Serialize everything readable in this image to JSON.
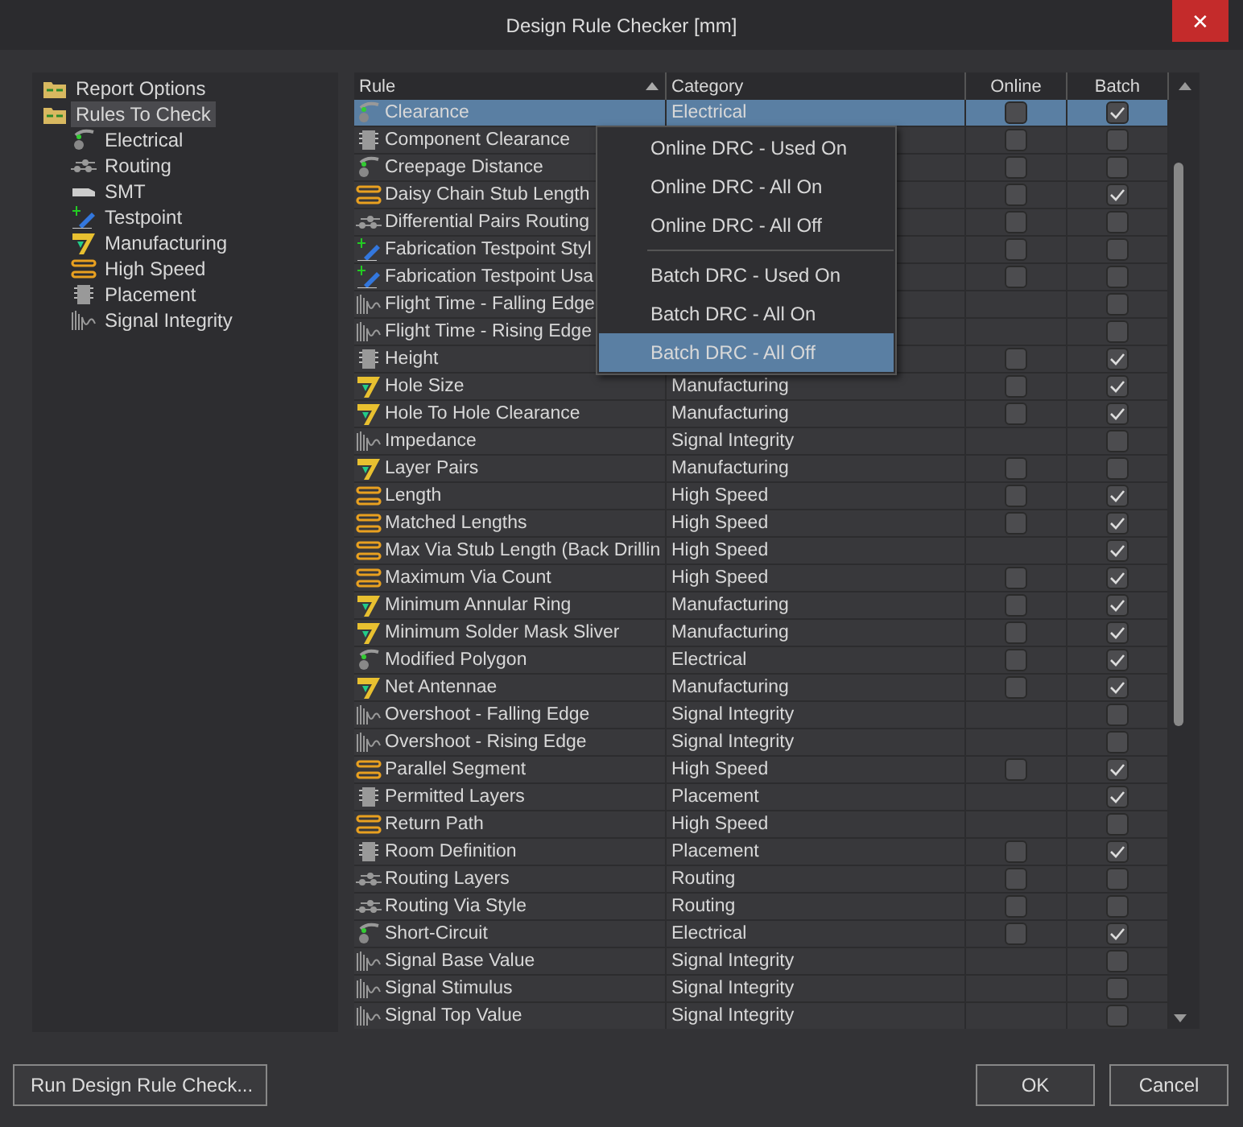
{
  "window": {
    "title": "Design Rule Checker [mm]",
    "close": "✕"
  },
  "tree": [
    {
      "label": "Report Options",
      "kind": "folder",
      "selected": false
    },
    {
      "label": "Rules To Check",
      "kind": "folder",
      "selected": true,
      "children": [
        {
          "label": "Electrical",
          "kind": "electrical"
        },
        {
          "label": "Routing",
          "kind": "routing"
        },
        {
          "label": "SMT",
          "kind": "smt"
        },
        {
          "label": "Testpoint",
          "kind": "testpoint"
        },
        {
          "label": "Manufacturing",
          "kind": "manufacturing"
        },
        {
          "label": "High Speed",
          "kind": "highspeed"
        },
        {
          "label": "Placement",
          "kind": "placement"
        },
        {
          "label": "Signal Integrity",
          "kind": "signal"
        }
      ]
    }
  ],
  "table": {
    "columns": [
      "Rule",
      "Category",
      "Online",
      "Batch"
    ],
    "rows": [
      {
        "rule": "Clearance",
        "kind": "electrical",
        "category": "Electrical",
        "online": false,
        "batch": true,
        "selected": true
      },
      {
        "rule": "Component Clearance",
        "kind": "placement",
        "online": false,
        "batch": false,
        "selected": false
      },
      {
        "rule": "Creepage Distance",
        "kind": "electrical",
        "online": false,
        "batch": false,
        "selected": false
      },
      {
        "rule": "Daisy Chain Stub Length",
        "kind": "highspeed",
        "online": false,
        "batch": true,
        "selected": false
      },
      {
        "rule": "Differential Pairs Routing",
        "kind": "routing",
        "online": false,
        "batch": false,
        "selected": false
      },
      {
        "rule": "Fabrication Testpoint Styl",
        "kind": "testpoint",
        "online": false,
        "batch": false,
        "selected": false
      },
      {
        "rule": "Fabrication Testpoint Usa",
        "kind": "testpoint",
        "online": false,
        "batch": false,
        "selected": false
      },
      {
        "rule": "Flight Time - Falling Edge",
        "kind": "signal",
        "batch": false,
        "selected": false
      },
      {
        "rule": "Flight Time - Rising Edge",
        "kind": "signal",
        "batch": false,
        "selected": false
      },
      {
        "rule": "Height",
        "kind": "placement",
        "online": false,
        "batch": true,
        "selected": false
      },
      {
        "rule": "Hole Size",
        "kind": "manufacturing",
        "category": "Manufacturing",
        "online": false,
        "batch": true,
        "selected": false
      },
      {
        "rule": "Hole To Hole Clearance",
        "kind": "manufacturing",
        "category": "Manufacturing",
        "online": false,
        "batch": true,
        "selected": false
      },
      {
        "rule": "Impedance",
        "kind": "signal",
        "category": "Signal Integrity",
        "batch": false,
        "selected": false
      },
      {
        "rule": "Layer Pairs",
        "kind": "manufacturing",
        "category": "Manufacturing",
        "online": false,
        "batch": false,
        "selected": false
      },
      {
        "rule": "Length",
        "kind": "highspeed",
        "category": "High Speed",
        "online": false,
        "batch": true,
        "selected": false
      },
      {
        "rule": "Matched Lengths",
        "kind": "highspeed",
        "category": "High Speed",
        "online": false,
        "batch": true,
        "selected": false
      },
      {
        "rule": "Max Via Stub Length (Back Drillin",
        "kind": "highspeed",
        "category": "High Speed",
        "batch": true,
        "selected": false
      },
      {
        "rule": "Maximum Via Count",
        "kind": "highspeed",
        "category": "High Speed",
        "online": false,
        "batch": true,
        "selected": false
      },
      {
        "rule": "Minimum Annular Ring",
        "kind": "manufacturing",
        "category": "Manufacturing",
        "online": false,
        "batch": true,
        "selected": false
      },
      {
        "rule": "Minimum Solder Mask Sliver",
        "kind": "manufacturing",
        "category": "Manufacturing",
        "online": false,
        "batch": true,
        "selected": false
      },
      {
        "rule": "Modified Polygon",
        "kind": "electrical",
        "category": "Electrical",
        "online": false,
        "batch": true,
        "selected": false
      },
      {
        "rule": "Net Antennae",
        "kind": "manufacturing",
        "category": "Manufacturing",
        "online": false,
        "batch": true,
        "selected": false
      },
      {
        "rule": "Overshoot - Falling Edge",
        "kind": "signal",
        "category": "Signal Integrity",
        "batch": false,
        "selected": false
      },
      {
        "rule": "Overshoot - Rising Edge",
        "kind": "signal",
        "category": "Signal Integrity",
        "batch": false,
        "selected": false
      },
      {
        "rule": "Parallel Segment",
        "kind": "highspeed",
        "category": "High Speed",
        "online": false,
        "batch": true,
        "selected": false
      },
      {
        "rule": "Permitted Layers",
        "kind": "placement",
        "category": "Placement",
        "batch": true,
        "selected": false
      },
      {
        "rule": "Return Path",
        "kind": "highspeed",
        "category": "High Speed",
        "batch": false,
        "selected": false
      },
      {
        "rule": "Room Definition",
        "kind": "placement",
        "category": "Placement",
        "online": false,
        "batch": true,
        "selected": false
      },
      {
        "rule": "Routing Layers",
        "kind": "routing",
        "category": "Routing",
        "online": false,
        "batch": false,
        "selected": false
      },
      {
        "rule": "Routing Via Style",
        "kind": "routing",
        "category": "Routing",
        "online": false,
        "batch": false,
        "selected": false
      },
      {
        "rule": "Short-Circuit",
        "kind": "electrical",
        "category": "Electrical",
        "online": false,
        "batch": true,
        "selected": false
      },
      {
        "rule": "Signal Base Value",
        "kind": "signal",
        "category": "Signal Integrity",
        "batch": false,
        "selected": false
      },
      {
        "rule": "Signal Stimulus",
        "kind": "signal",
        "category": "Signal Integrity",
        "batch": false,
        "selected": false
      },
      {
        "rule": "Signal Top Value",
        "kind": "signal",
        "category": "Signal Integrity",
        "batch": false,
        "selected": false
      }
    ]
  },
  "context_menu": {
    "groups": [
      [
        {
          "label": "Online DRC - Used On",
          "selected": false
        },
        {
          "label": "Online DRC - All On",
          "selected": false
        },
        {
          "label": "Online DRC - All Off",
          "selected": false
        }
      ],
      [
        {
          "label": "Batch DRC - Used On",
          "selected": false
        },
        {
          "label": "Batch DRC - All On",
          "selected": false
        },
        {
          "label": "Batch DRC - All Off",
          "selected": true
        }
      ]
    ]
  },
  "buttons": {
    "run": "Run Design Rule Check...",
    "ok": "OK",
    "cancel": "Cancel"
  }
}
